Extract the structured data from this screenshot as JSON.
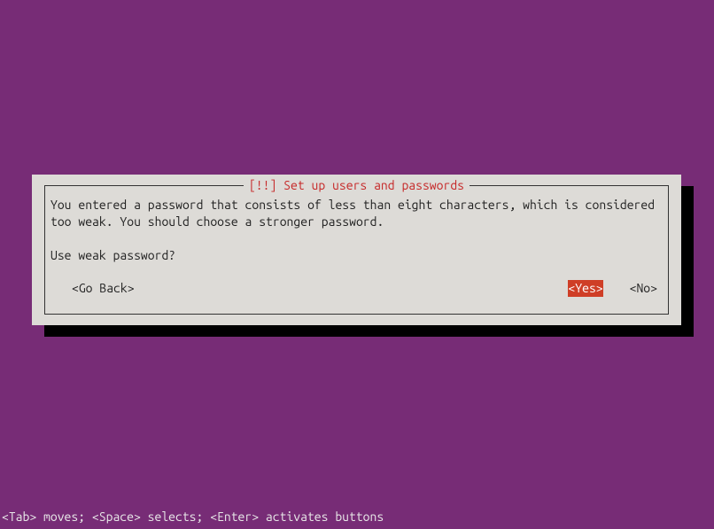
{
  "dialog": {
    "title": "[!!] Set up users and passwords",
    "message": "You entered a password that consists of less than eight characters, which is considered too weak. You should choose a stronger password.",
    "question": "Use weak password?",
    "buttons": {
      "go_back": "<Go Back>",
      "yes": "<Yes>",
      "no": "<No>"
    },
    "selected": "yes"
  },
  "footer": "<Tab> moves; <Space> selects; <Enter> activates buttons"
}
